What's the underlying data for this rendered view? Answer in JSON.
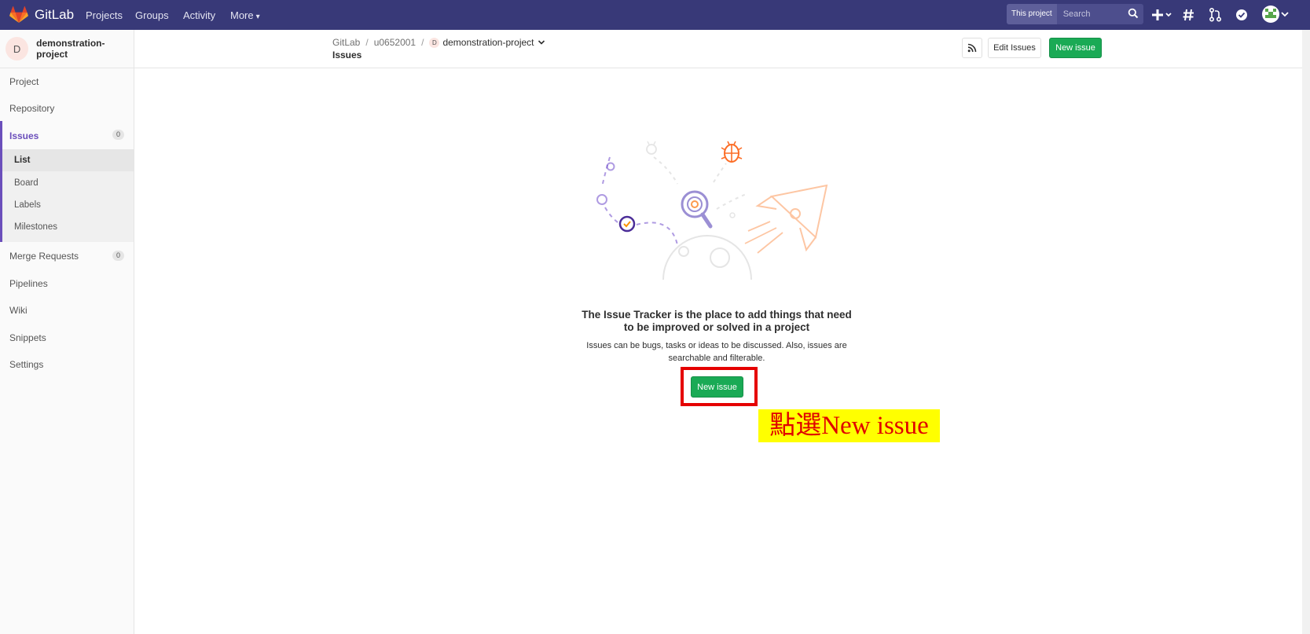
{
  "navbar": {
    "brand": "GitLab",
    "links": [
      "Projects",
      "Groups",
      "Activity",
      "More"
    ],
    "search_scope": "This project",
    "search_placeholder": "Search"
  },
  "sidebar": {
    "avatar_letter": "D",
    "project_name": "demonstration-project",
    "items": [
      "Project",
      "Repository"
    ],
    "issues": {
      "label": "Issues",
      "count": "0",
      "sub": [
        "List",
        "Board",
        "Labels",
        "Milestones"
      ]
    },
    "more_items": [
      {
        "label": "Merge Requests",
        "count": "0"
      },
      {
        "label": "Pipelines"
      },
      {
        "label": "Wiki"
      },
      {
        "label": "Snippets"
      },
      {
        "label": "Settings"
      }
    ]
  },
  "breadcrumb": {
    "items": [
      "GitLab",
      "u0652001"
    ],
    "avatar_letter": "D",
    "project": "demonstration-project",
    "page_title": "Issues"
  },
  "actions": {
    "edit_label": "Edit Issues",
    "new_label": "New issue"
  },
  "empty_state": {
    "title": "The Issue Tracker is the place to add things that need to be improved or solved in a project",
    "description": "Issues can be bugs, tasks or ideas to be discussed. Also, issues are searchable and filterable.",
    "button_label": "New issue"
  },
  "annotation": "點選New issue",
  "colors": {
    "navbar": "#383978",
    "accent": "#6b4fbb",
    "primary_button": "#1aaa55",
    "highlight_frame": "#e50000",
    "annotation_bg": "#ffff00"
  }
}
